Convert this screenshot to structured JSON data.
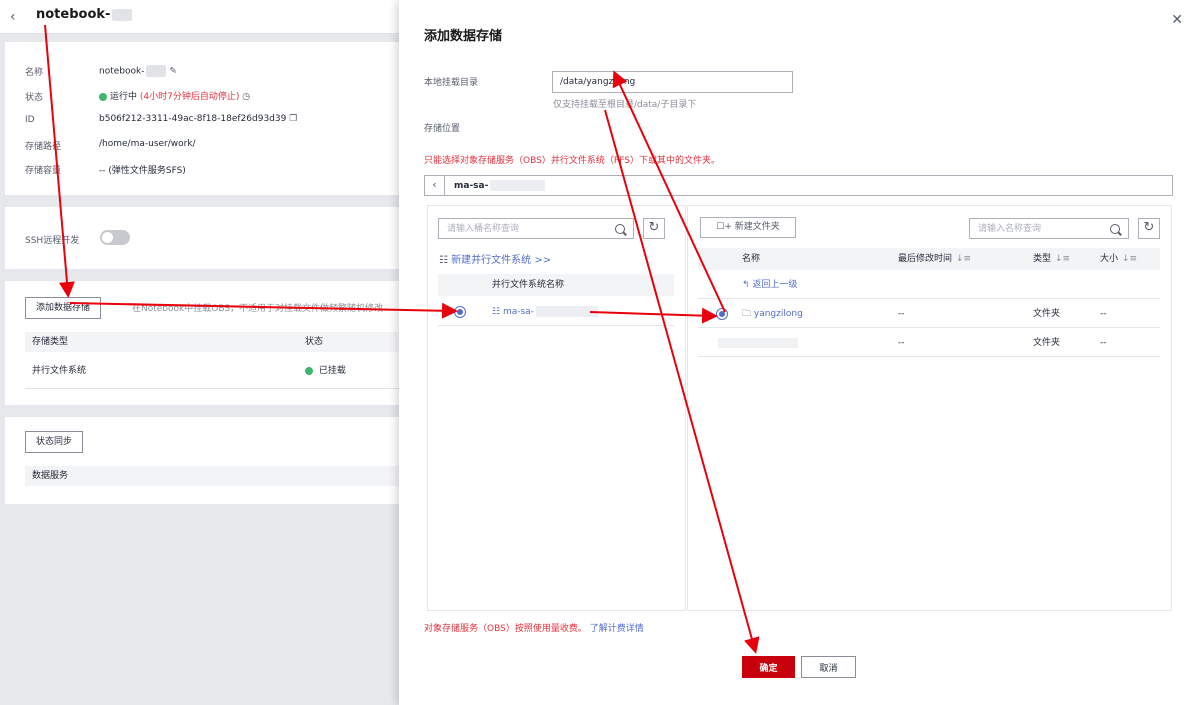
{
  "background": {
    "back_icon": "chevron-left-icon",
    "title": "notebook-",
    "info": {
      "name_label": "名称",
      "name_value": "notebook-",
      "edit_icon": "pencil-icon",
      "status_label": "状态",
      "status_value": "运行中",
      "status_extra": "(4小时7分钟后自动停止)",
      "timer_icon": "clock-icon",
      "id_label": "ID",
      "id_value": "b506f212-3311-49ac-8f18-18ef26d93d39",
      "copy_icon": "copy-icon",
      "path_label": "存储路径",
      "path_value": "/home/ma-user/work/",
      "capacity_label": "存储容量",
      "capacity_value": "-- (弹性文件服务SFS)"
    },
    "ssh_label": "SSH远程开发",
    "add_storage_button": "添加数据存储",
    "add_storage_hint": "在Notebook中挂载OBS，不适用于对挂载文件做频繁随机修改",
    "storage_table": {
      "col_type": "存储类型",
      "col_status": "状态",
      "row_type": "并行文件系统",
      "row_status": "已挂载"
    },
    "sync_button": "状态同步",
    "data_service_header": "数据服务"
  },
  "drawer": {
    "title": "添加数据存储",
    "close_icon": "close-icon",
    "mount_dir_label": "本地挂载目录",
    "mount_dir_value": "/data/yangzilong",
    "mount_dir_hint": "仅支持挂载至根目录/data/子目录下",
    "storage_location_label": "存储位置",
    "warning": "只能选择对象存储服务（OBS）并行文件系统（PFS）下或其中的文件夹。",
    "bucket_bar_value": "ma-sa-",
    "left_panel": {
      "search_placeholder": "请输入桶名称查询",
      "new_pfs_link": "新建并行文件系统 >>",
      "column_header": "并行文件系统名称",
      "rows": [
        {
          "name": "ma-sa-",
          "selected": true
        }
      ]
    },
    "right_panel": {
      "new_folder_button": "新建文件夹",
      "search_placeholder": "请输入名称查询",
      "columns": {
        "name": "名称",
        "modified": "最后修改时间",
        "type": "类型",
        "size": "大小"
      },
      "back_link": "返回上一级",
      "rows": [
        {
          "name": "yangzilong",
          "modified": "--",
          "type": "文件夹",
          "size": "--",
          "selected": true
        },
        {
          "name": "",
          "modified": "--",
          "type": "文件夹",
          "size": "--",
          "selected": false
        }
      ]
    },
    "footer_note": "对象存储服务（OBS）按照使用量收费。",
    "pricing_link": "了解计费详情",
    "confirm_button": "确定",
    "cancel_button": "取消"
  },
  "colors": {
    "primary_red": "#c7000b",
    "link_blue": "#526ecc",
    "warning_red": "#e3323d",
    "annotation_red": "#e8000b",
    "success_green": "#3fb66d"
  }
}
